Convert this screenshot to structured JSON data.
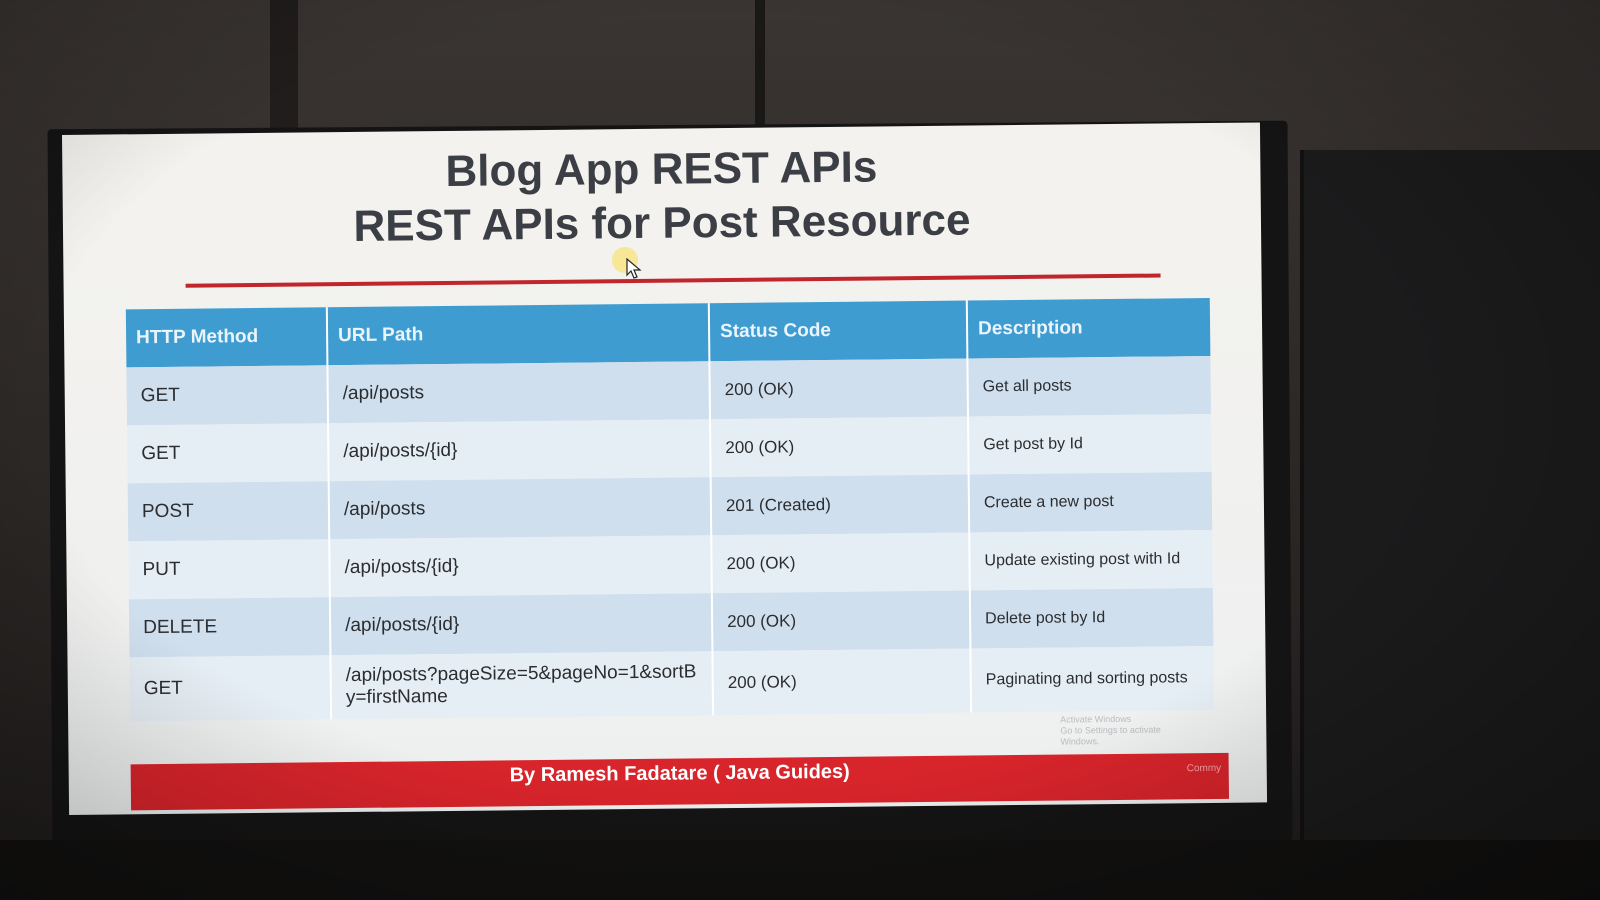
{
  "slide": {
    "title_line1": "Blog App REST APIs",
    "title_line2": "REST APIs for Post Resource",
    "accent_color": "#c0262c",
    "header_color": "#3f9cd1"
  },
  "table": {
    "headers": [
      "HTTP Method",
      "URL Path",
      "Status Code",
      "Description"
    ],
    "rows": [
      {
        "method": "GET",
        "path": "/api/posts",
        "status": "200 (OK)",
        "description": "Get all posts"
      },
      {
        "method": "GET",
        "path": "/api/posts/{id}",
        "status": "200 (OK)",
        "description": "Get post by Id"
      },
      {
        "method": "POST",
        "path": "/api/posts",
        "status": "201 (Created)",
        "description": "Create a new post"
      },
      {
        "method": "PUT",
        "path": "/api/posts/{id}",
        "status": "200 (OK)",
        "description": "Update existing post with Id"
      },
      {
        "method": "DELETE",
        "path": "/api/posts/{id}",
        "status": "200 (OK)",
        "description": "Delete post by Id"
      },
      {
        "method": "GET",
        "path": "/api/posts?pageSize=5&pageNo=1&sortBy=firstName",
        "status": "200 (OK)",
        "description": "Paginating and sorting posts"
      }
    ]
  },
  "footer": {
    "text": "By Ramesh Fadatare ( Java Guides)",
    "color": "#d8242b"
  },
  "overlay": {
    "watermark_line1": "Activate Windows",
    "watermark_line2": "Go to Settings to activate Windows.",
    "brand_tag": "Commy"
  },
  "icons": {
    "cursor": "mouse-pointer-icon"
  }
}
